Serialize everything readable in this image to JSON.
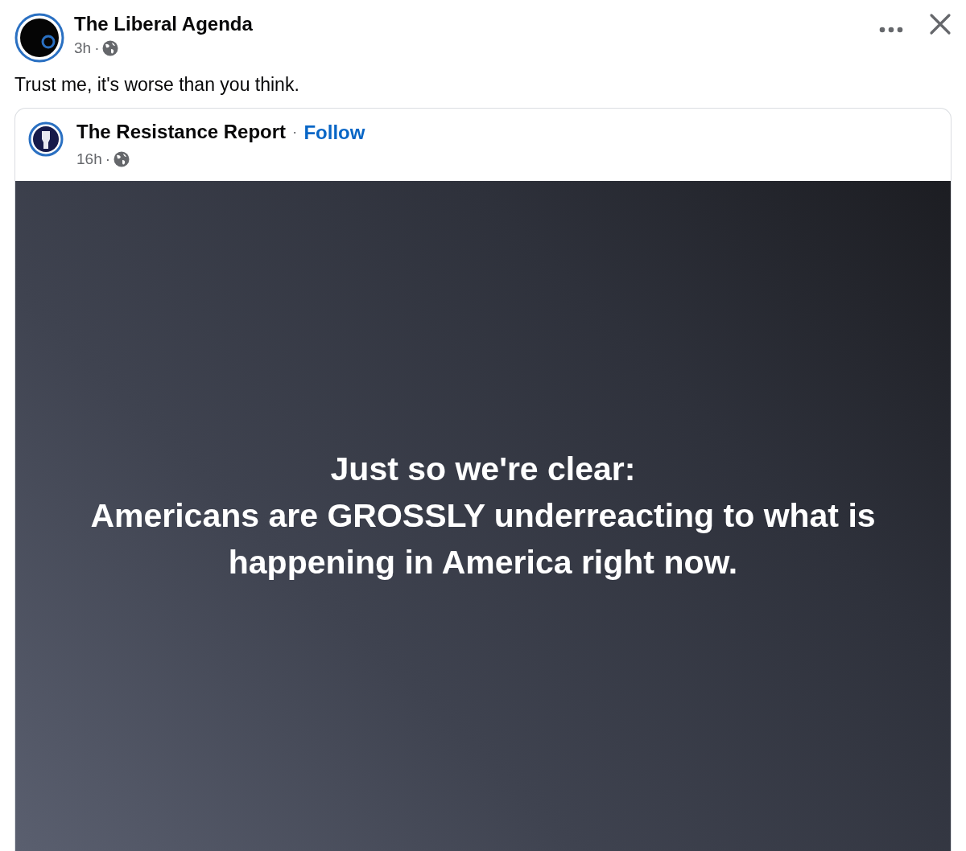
{
  "post": {
    "author": "The Liberal Agenda",
    "time": "3h",
    "separator": "·",
    "caption": "Trust me, it's worse than you think.",
    "shared": {
      "author": "The Resistance Report",
      "author_separator": "·",
      "follow": "Follow",
      "time": "16h",
      "separator": "·",
      "text_lines": [
        "Just so we're clear:",
        "Americans are GROSSLY underreacting to what is happening in America right now."
      ]
    }
  }
}
